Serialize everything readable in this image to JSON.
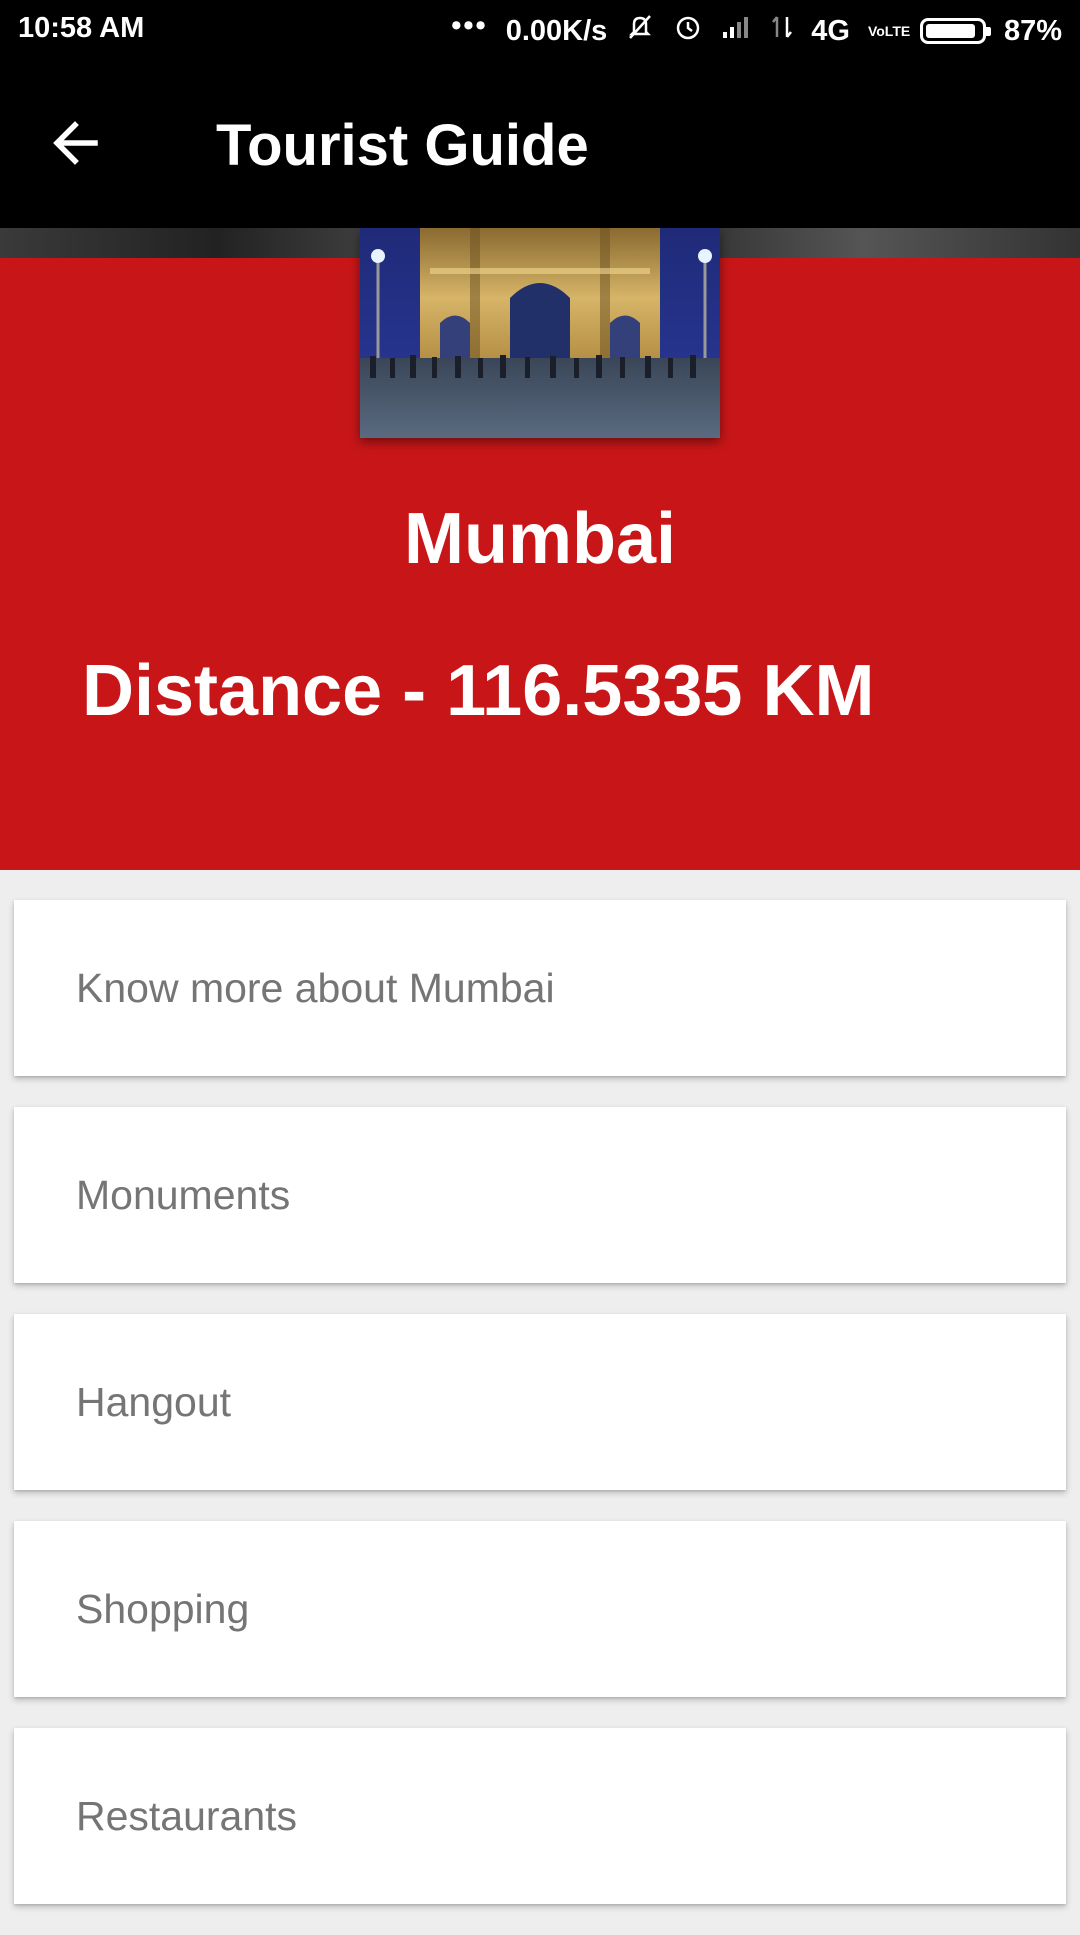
{
  "status_bar": {
    "time": "10:58 AM",
    "dots": "•••",
    "network_speed": "0.00K/s",
    "network_type": "4G",
    "volte": "VoLTE",
    "battery": "87%",
    "icons": [
      "vibrate-off-icon",
      "alarm-icon",
      "signal-icon",
      "data-arrows-icon",
      "battery-icon"
    ]
  },
  "app_bar": {
    "title": "Tourist Guide",
    "back_icon": "arrow-back-icon"
  },
  "header": {
    "city": "Mumbai",
    "distance": "Distance - 116.5335 KM",
    "image": "gateway-of-india-photo"
  },
  "menu": {
    "items": [
      {
        "label": "Know more about Mumbai"
      },
      {
        "label": "Monuments"
      },
      {
        "label": "Hangout"
      },
      {
        "label": "Shopping"
      },
      {
        "label": "Restaurants"
      }
    ]
  },
  "colors": {
    "accent_red": "#c81618",
    "app_bar": "#000000",
    "card_text": "#757575"
  }
}
